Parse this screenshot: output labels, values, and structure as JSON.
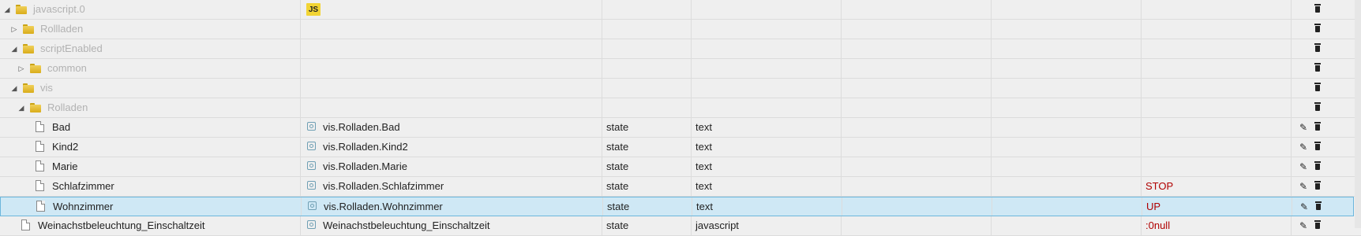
{
  "rows": [
    {
      "name": "javascript.0",
      "kind": "folder",
      "expanded": true,
      "level": 0,
      "greyed": true,
      "badge": "JS",
      "id": "",
      "type": "",
      "role": "",
      "value": "",
      "editable": false
    },
    {
      "name": "Rollladen",
      "kind": "folder",
      "expanded": false,
      "level": 1,
      "greyed": true,
      "id": "",
      "type": "",
      "role": "",
      "value": "",
      "editable": false
    },
    {
      "name": "scriptEnabled",
      "kind": "folder",
      "expanded": true,
      "level": 1,
      "greyed": true,
      "id": "",
      "type": "",
      "role": "",
      "value": "",
      "editable": false
    },
    {
      "name": "common",
      "kind": "folder",
      "expanded": false,
      "level": 2,
      "greyed": true,
      "id": "",
      "type": "",
      "role": "",
      "value": "",
      "editable": false
    },
    {
      "name": "vis",
      "kind": "folder",
      "expanded": true,
      "level": 1,
      "greyed": true,
      "id": "",
      "type": "",
      "role": "",
      "value": "",
      "editable": false
    },
    {
      "name": "Rolladen",
      "kind": "folder",
      "expanded": true,
      "level": 2,
      "greyed": true,
      "id": "",
      "type": "",
      "role": "",
      "value": "",
      "editable": false
    },
    {
      "name": "Bad",
      "kind": "state",
      "level": 3,
      "greyed": false,
      "id": "vis.Rolladen.Bad",
      "type": "state",
      "role": "text",
      "value": "",
      "editable": true
    },
    {
      "name": "Kind2",
      "kind": "state",
      "level": 3,
      "greyed": false,
      "id": "vis.Rolladen.Kind2",
      "type": "state",
      "role": "text",
      "value": "",
      "editable": true
    },
    {
      "name": "Marie",
      "kind": "state",
      "level": 3,
      "greyed": false,
      "id": "vis.Rolladen.Marie",
      "type": "state",
      "role": "text",
      "value": "",
      "editable": true
    },
    {
      "name": "Schlafzimmer",
      "kind": "state",
      "level": 3,
      "greyed": false,
      "id": "vis.Rolladen.Schlafzimmer",
      "type": "state",
      "role": "text",
      "value": "STOP",
      "editable": true
    },
    {
      "name": "Wohnzimmer",
      "kind": "state",
      "level": 3,
      "greyed": false,
      "id": "vis.Rolladen.Wohnzimmer",
      "type": "state",
      "role": "text",
      "value": "UP",
      "editable": true,
      "selected": true
    },
    {
      "name": "Weinachstbeleuchtung_Einschaltzeit",
      "kind": "state",
      "level": 1,
      "greyed": false,
      "id": "Weinachstbeleuchtung_Einschaltzeit",
      "type": "state",
      "role": "javascript",
      "value": ":0null",
      "editable": true
    }
  ],
  "icons": {
    "expanded": "triangle-down-icon",
    "collapsed": "triangle-right-icon",
    "edit": "pencil-icon",
    "delete": "trash-icon"
  },
  "colors": {
    "value": "#b00000",
    "selected_bg": "#cfe8f5",
    "selected_border": "#6cb6dc",
    "badge": "#f2d434"
  }
}
